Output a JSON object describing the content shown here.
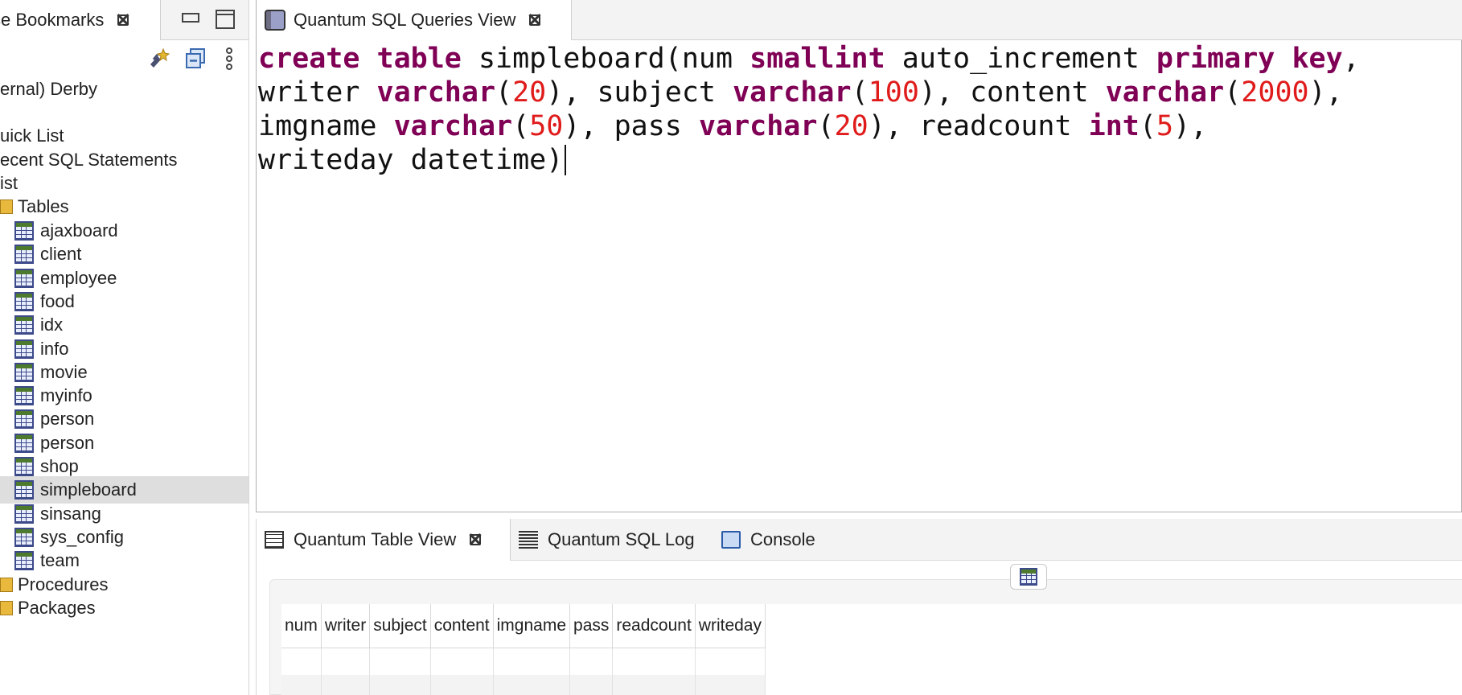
{
  "left_panel": {
    "tab_title": "se Bookmarks",
    "tree": {
      "connection": "ernal) Derby",
      "quick_list": "uick List",
      "recent_sql": "ecent SQL Statements",
      "list": "ist",
      "tables_label": "Tables",
      "tables": [
        "ajaxboard",
        "client",
        "employee",
        "food",
        "idx",
        "info",
        "movie",
        "myinfo",
        "person",
        "person",
        "shop",
        "simpleboard",
        "sinsang",
        "sys_config",
        "team"
      ],
      "selected_table": "simpleboard",
      "procedures_label": "Procedures",
      "packages_label": "Packages"
    }
  },
  "editor": {
    "tab_title": "Quantum SQL Queries View",
    "sql_lines": [
      "create table simpleboard(num smallint auto_increment primary key,",
      "writer varchar(20), subject varchar(100), content varchar(2000),",
      "imgname varchar(50), pass varchar(20), readcount int(5),",
      "writeday datetime)"
    ]
  },
  "bottom_panel": {
    "tabs": [
      {
        "label": "Quantum Table View",
        "active": true,
        "icon": "table-view-icon"
      },
      {
        "label": "Quantum SQL Log",
        "active": false,
        "icon": "sql-log-icon"
      },
      {
        "label": "Console",
        "active": false,
        "icon": "console-icon"
      }
    ],
    "result_columns": [
      "num",
      "writer",
      "subject",
      "content",
      "imgname",
      "pass",
      "readcount",
      "writeday"
    ]
  },
  "colors": {
    "keyword": "#7f0055",
    "number": "#e01b1b",
    "selected_row": "#dedede"
  }
}
